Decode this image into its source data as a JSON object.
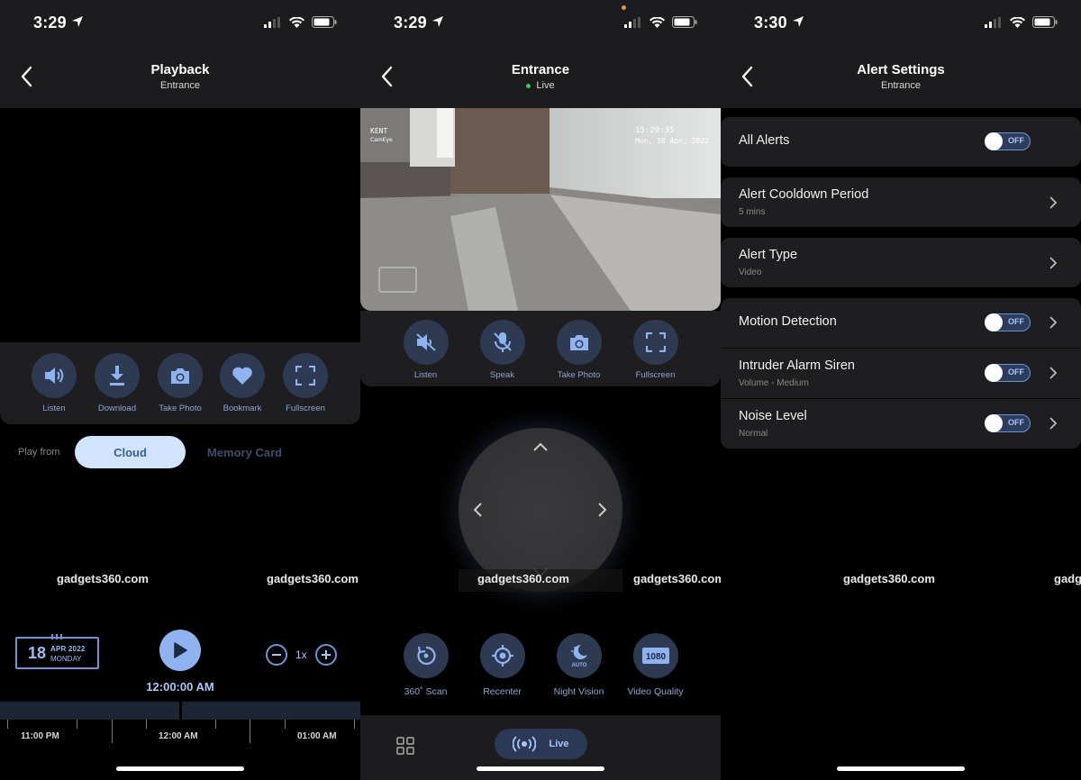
{
  "status": {
    "time_p1": "3:29",
    "time_p2": "3:29",
    "time_p3": "3:30"
  },
  "playback": {
    "title": "Playback",
    "subtitle": "Entrance",
    "actions": [
      {
        "label": "Listen",
        "icon": "speaker-icon"
      },
      {
        "label": "Download",
        "icon": "download-icon"
      },
      {
        "label": "Take Photo",
        "icon": "camera-icon"
      },
      {
        "label": "Bookmark",
        "icon": "heart-icon"
      },
      {
        "label": "Fullscreen",
        "icon": "fullscreen-icon"
      }
    ],
    "play_from_label": "Play from",
    "sources": [
      "Cloud",
      "Memory Card"
    ],
    "selected_source": "Cloud",
    "date": {
      "day": "18",
      "month_year": "APR 2022",
      "weekday": "MONDAY"
    },
    "speed": "1x",
    "timestamp": "12:00:00 AM",
    "timeline_labels": [
      "11:00 PM",
      "12:00 AM",
      "01:00 AM"
    ]
  },
  "live": {
    "title": "Entrance",
    "status": "Live",
    "osd_brand": "KENT",
    "osd_brand_sub": "CamEye",
    "osd_time": "15:29:35",
    "osd_date": "Mon, 18 Apr, 2022",
    "controls": [
      {
        "label": "Listen",
        "icon": "speaker-muted-icon"
      },
      {
        "label": "Speak",
        "icon": "mic-muted-icon"
      },
      {
        "label": "Take Photo",
        "icon": "camera-icon"
      },
      {
        "label": "Fullscreen",
        "icon": "fullscreen-icon"
      }
    ],
    "features": [
      {
        "label": "360˚ Scan",
        "icon": "rotate-icon"
      },
      {
        "label": "Recenter",
        "icon": "target-icon"
      },
      {
        "label": "Night Vision",
        "icon": "night-vision-icon",
        "badge": "AUTO"
      },
      {
        "label": "Video Quality",
        "icon": "video-quality-icon",
        "badge": "1080"
      }
    ],
    "tab_live": "Live"
  },
  "alerts": {
    "title": "Alert Settings",
    "subtitle": "Entrance",
    "rows": [
      {
        "title": "All Alerts",
        "sub": "",
        "toggle": "OFF",
        "chevron": false
      },
      {
        "title": "Alert Cooldown Period",
        "sub": "5 mins",
        "toggle": "",
        "chevron": true
      },
      {
        "title": "Alert Type",
        "sub": "Video",
        "toggle": "",
        "chevron": true
      },
      {
        "title": "Motion Detection",
        "sub": "",
        "toggle": "OFF",
        "chevron": true
      },
      {
        "title": "Intruder Alarm Siren",
        "sub": "Volume - Medium",
        "toggle": "OFF",
        "chevron": true
      },
      {
        "title": "Noise Level",
        "sub": "Normal",
        "toggle": "OFF",
        "chevron": true
      }
    ]
  },
  "watermark": "gadgets360.com",
  "watermark_partial": "gadg",
  "colors": {
    "accent": "#8fb3f0",
    "icon_circle": "#2e3a52",
    "card": "#1e1e21",
    "live": "#3cc55a"
  }
}
